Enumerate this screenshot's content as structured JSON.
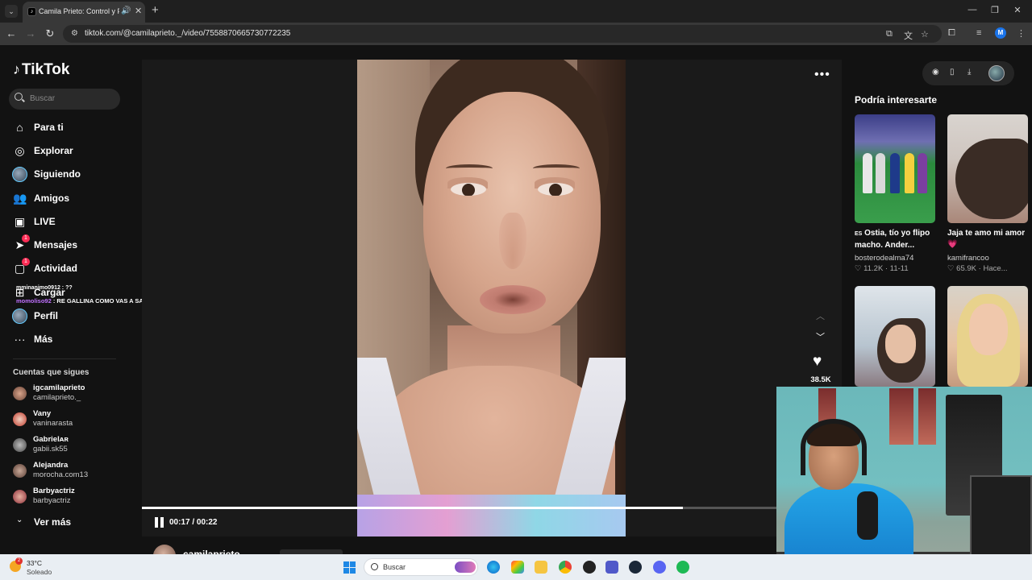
{
  "browser": {
    "tab_title": "Camila Prieto: Control y Pa",
    "url": "tiktok.com/@camilaprieto._/video/7558870665730772235",
    "profile_initial": "M"
  },
  "sidebar": {
    "logo": "TikTok",
    "search_placeholder": "Buscar",
    "nav": [
      {
        "label": "Para ti",
        "icon": "home-icon"
      },
      {
        "label": "Explorar",
        "icon": "compass-icon"
      },
      {
        "label": "Siguiendo",
        "icon": "following-avatar-icon"
      },
      {
        "label": "Amigos",
        "icon": "friends-icon"
      },
      {
        "label": "LIVE",
        "icon": "live-icon"
      },
      {
        "label": "Mensajes",
        "icon": "messages-icon",
        "badge": "1"
      },
      {
        "label": "Actividad",
        "icon": "activity-icon",
        "badge": "1"
      },
      {
        "label": "Cargar",
        "icon": "upload-icon"
      },
      {
        "label": "Perfil",
        "icon": "profile-avatar-icon"
      },
      {
        "label": "Más",
        "icon": "more-icon"
      }
    ],
    "following_title": "Cuentas que sigues",
    "following": [
      {
        "name": "igcamilaprieto",
        "user": "camilaprieto._"
      },
      {
        "name": "Vany",
        "user": "vaninarasta"
      },
      {
        "name": "Gabrielᴀʀ",
        "user": "gabii.sk55"
      },
      {
        "name": "Alejandra",
        "user": "morocha.com13"
      },
      {
        "name": "Barbyactriz",
        "user": "barbyactriz"
      }
    ],
    "see_more": "Ver más"
  },
  "chat": {
    "line1": "mminanimo0912 : ??",
    "line2_user": "momoliso92",
    "line2_text": " : RE GALLINA COMO VAS A SABER MULTIPLICAR"
  },
  "player": {
    "likes": "38.5K",
    "time": "00:17 / 00:22",
    "progress": 0.7727,
    "author": "camilaprieto"
  },
  "recommendations": {
    "title": "Podría interesarte",
    "items": [
      {
        "caption_prefix": "ES",
        "caption": "Ostia, tío yo flipo macho. Ander...",
        "user": "bosterodealma74",
        "likes": "11.2K",
        "date": "11-11"
      },
      {
        "caption": "Jaja te amo mi amor 💗",
        "user": "kamifrancoo",
        "likes": "65.9K",
        "date": "Hace..."
      }
    ]
  },
  "taskbar": {
    "temp": "33°C",
    "condition": "Soleado",
    "weather_badge": "2",
    "search": "Buscar"
  },
  "colors": {
    "accent": "#fe2c55",
    "page_bg": "#121212",
    "chat_user": "#c070ff"
  }
}
